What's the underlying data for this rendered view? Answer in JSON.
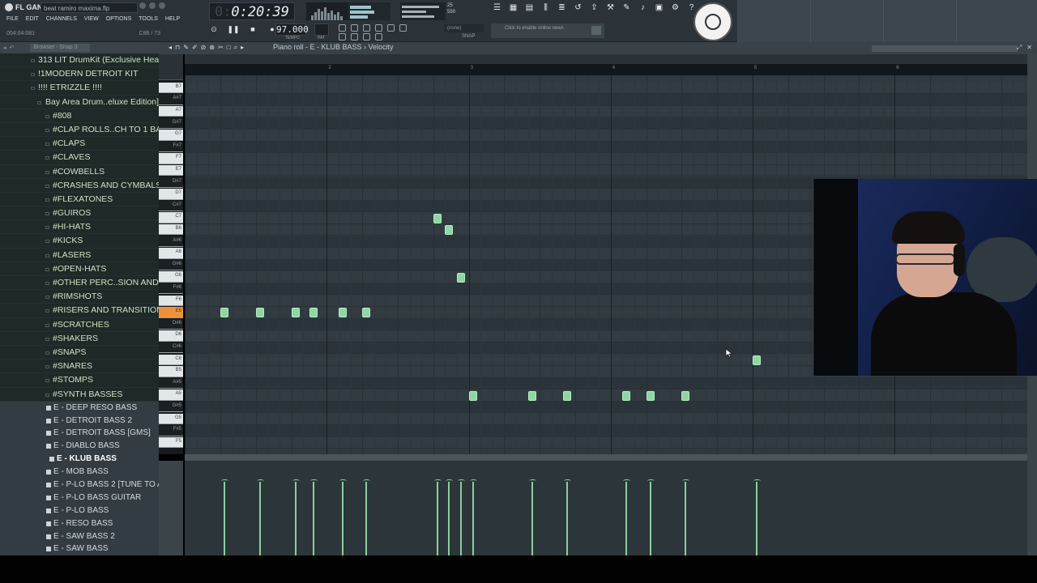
{
  "app": {
    "logo_label": "FL GANG",
    "project_name": "beat ramiro maxima.flp",
    "menu": [
      "FILE",
      "EDIT",
      "CHANNELS",
      "VIEW",
      "OPTIONS",
      "TOOLS",
      "HELP"
    ],
    "hint_left": "004:04:081",
    "hint_right": "C86 / 73"
  },
  "transport": {
    "time": "0:20:39",
    "time_ghost": "0:",
    "tempo": "97.000",
    "tempo_label": "TEMPO",
    "pattern_label": "PAT",
    "pattern_name": "(none)",
    "snap_label": "SNAP",
    "cpu_value": "25",
    "ram_value": "550",
    "cpu_label": "CPU",
    "poly_label": "POLY",
    "news_text": "Click to enable online news"
  },
  "browser": {
    "header_label": "Browser - Snap 3",
    "items": [
      {
        "label": "313 LIT DrumKit (Exclusive Heat)",
        "level": 1,
        "kind": "folder"
      },
      {
        "label": "!1MODERN DETROIT KIT",
        "level": 1,
        "kind": "folder"
      },
      {
        "label": "!!!! ETRIZZLE !!!!",
        "level": 1,
        "kind": "folder"
      },
      {
        "label": "Bay Area Drum..eluxe Edition]",
        "level": 2,
        "kind": "folder"
      },
      {
        "label": "#808",
        "level": 3,
        "kind": "folder"
      },
      {
        "label": "#CLAP ROLLS..CH TO 1 BAR)",
        "level": 3,
        "kind": "folder"
      },
      {
        "label": "#CLAPS",
        "level": 3,
        "kind": "folder"
      },
      {
        "label": "#CLAVES",
        "level": 3,
        "kind": "folder"
      },
      {
        "label": "#COWBELLS",
        "level": 3,
        "kind": "folder"
      },
      {
        "label": "#CRASHES AND CYMBALS",
        "level": 3,
        "kind": "folder"
      },
      {
        "label": "#FLEXATONES",
        "level": 3,
        "kind": "folder"
      },
      {
        "label": "#GUIROS",
        "level": 3,
        "kind": "folder"
      },
      {
        "label": "#HI-HATS",
        "level": 3,
        "kind": "folder"
      },
      {
        "label": "#KICKS",
        "level": 3,
        "kind": "folder"
      },
      {
        "label": "#LASERS",
        "level": 3,
        "kind": "folder"
      },
      {
        "label": "#OPEN-HATS",
        "level": 3,
        "kind": "folder"
      },
      {
        "label": "#OTHER PERC..SION AND FX",
        "level": 3,
        "kind": "folder"
      },
      {
        "label": "#RIMSHOTS",
        "level": 3,
        "kind": "folder"
      },
      {
        "label": "#RISERS AND TRANSITIONS",
        "level": 3,
        "kind": "folder"
      },
      {
        "label": "#SCRATCHES",
        "level": 3,
        "kind": "folder"
      },
      {
        "label": "#SHAKERS",
        "level": 3,
        "kind": "folder"
      },
      {
        "label": "#SNAPS",
        "level": 3,
        "kind": "folder"
      },
      {
        "label": "#SNARES",
        "level": 3,
        "kind": "folder"
      },
      {
        "label": "#STOMPS",
        "level": 3,
        "kind": "folder"
      },
      {
        "label": "#SYNTH BASSES",
        "level": 3,
        "kind": "folder"
      },
      {
        "label": "E - DEEP RESO BASS",
        "kind": "file"
      },
      {
        "label": "E - DETROIT BASS 2",
        "kind": "file"
      },
      {
        "label": "E - DETROIT BASS [GMS]",
        "kind": "file"
      },
      {
        "label": "E - DIABLO BASS",
        "kind": "file"
      },
      {
        "label": "E - KLUB BASS",
        "kind": "file",
        "selected": true
      },
      {
        "label": "E - MOB BASS",
        "kind": "file"
      },
      {
        "label": "E - P-LO BASS 2 [TUNE TO A#]",
        "kind": "file"
      },
      {
        "label": "E - P-LO BASS GUITAR",
        "kind": "file"
      },
      {
        "label": "E - P-LO BASS",
        "kind": "file"
      },
      {
        "label": "E - RESO BASS",
        "kind": "file"
      },
      {
        "label": "E - SAW BASS 2",
        "kind": "file"
      },
      {
        "label": "E - SAW BASS",
        "kind": "file"
      }
    ]
  },
  "piano_roll": {
    "title": "Piano roll - E - KLUB BASS › Velocity",
    "key_labels": [
      "B7",
      "A#7",
      "A7",
      "G#7",
      "G7",
      "F#7",
      "F7",
      "E7",
      "D#7",
      "D7",
      "C#7",
      "C7",
      "B6",
      "A#6",
      "A6",
      "G#6",
      "G6",
      "F#6",
      "F6",
      "E6",
      "D#6",
      "D6",
      "C#6",
      "C6",
      "B5",
      "A#5",
      "A5",
      "G#5",
      "G5",
      "F#5",
      "F5"
    ],
    "active_key": "E6",
    "bar_numbers": [
      "2",
      "3",
      "4",
      "5",
      "6",
      "7"
    ],
    "colors": {
      "note": "#8fd6a3",
      "active_key": "#f0913a",
      "grid": "#2f393f"
    },
    "notes": [
      {
        "pitch": "E6",
        "step": 0
      },
      {
        "pitch": "E6",
        "step": 3
      },
      {
        "pitch": "E6",
        "step": 6
      },
      {
        "pitch": "E6",
        "step": 7.5
      },
      {
        "pitch": "E6",
        "step": 10
      },
      {
        "pitch": "E6",
        "step": 12
      },
      {
        "pitch": "C7",
        "step": 18
      },
      {
        "pitch": "B6",
        "step": 19
      },
      {
        "pitch": "G6",
        "step": 20
      },
      {
        "pitch": "A5",
        "step": 21
      },
      {
        "pitch": "A5",
        "step": 26
      },
      {
        "pitch": "A5",
        "step": 29
      },
      {
        "pitch": "A5",
        "step": 34
      },
      {
        "pitch": "A5",
        "step": 36
      },
      {
        "pitch": "A5",
        "step": 39
      },
      {
        "pitch": "C6",
        "step": 45
      }
    ]
  }
}
